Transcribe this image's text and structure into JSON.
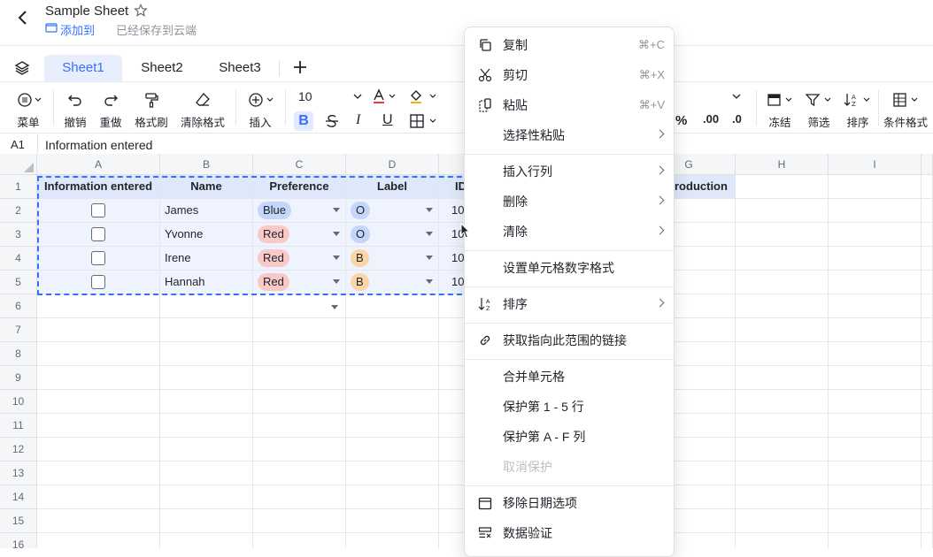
{
  "header": {
    "title": "Sample Sheet",
    "add_to": "添加到",
    "saved_status": "已经保存到云端"
  },
  "tabs": [
    {
      "label": "Sheet1",
      "active": true
    },
    {
      "label": "Sheet2"
    },
    {
      "label": "Sheet3"
    }
  ],
  "toolbar": {
    "menu": "菜单",
    "undo": "撤销",
    "redo": "重做",
    "format_painter": "格式刷",
    "clear_format": "清除格式",
    "insert": "插入",
    "font_size": "10",
    "bold": "B",
    "italic": "I",
    "underline": "U",
    "percent": "%",
    "dec_add": ".00",
    "dec_remove": ".0",
    "freeze": "冻结",
    "filter": "筛选",
    "sort": "排序",
    "conditional_format": "条件格式"
  },
  "formula_bar": {
    "cell_ref": "A1",
    "value": "Information entered"
  },
  "grid": {
    "columns": [
      "A",
      "B",
      "C",
      "D",
      "",
      "G",
      "H",
      "I"
    ],
    "rows": [
      "1",
      "2",
      "3",
      "4",
      "5",
      "6",
      "7",
      "8",
      "9",
      "10",
      "11",
      "12",
      "13",
      "14",
      "15",
      "16"
    ],
    "headers": [
      "Information entered",
      "Name",
      "Preference",
      "Label",
      "ID",
      "roduction"
    ],
    "data": [
      {
        "name": "James",
        "pref": "Blue",
        "label": "O",
        "id": "10"
      },
      {
        "name": "Yvonne",
        "pref": "Red",
        "label": "O",
        "id": "10"
      },
      {
        "name": "Irene",
        "pref": "Red",
        "label": "B",
        "id": "10"
      },
      {
        "name": "Hannah",
        "pref": "Red",
        "label": "B",
        "id": "10"
      }
    ]
  },
  "colors": {
    "accent": "#3370ff",
    "pill_blue": "#c5d6fb",
    "pill_red": "#f8c9c7",
    "pill_orange": "#fbd4a8"
  },
  "context_menu": {
    "copy": {
      "label": "复制",
      "shortcut": "⌘+C"
    },
    "cut": {
      "label": "剪切",
      "shortcut": "⌘+X"
    },
    "paste": {
      "label": "粘贴",
      "shortcut": "⌘+V"
    },
    "paste_special": "选择性粘贴",
    "insert_rowcol": "插入行列",
    "delete": "删除",
    "clear": "清除",
    "number_format": "设置单元格数字格式",
    "sort": "排序",
    "get_link": "获取指向此范围的链接",
    "merge": "合并单元格",
    "protect_rows": "保护第 1 - 5 行",
    "protect_cols": "保护第 A - F 列",
    "unprotect": "取消保护",
    "remove_date": "移除日期选项",
    "data_validation": "数据验证"
  }
}
